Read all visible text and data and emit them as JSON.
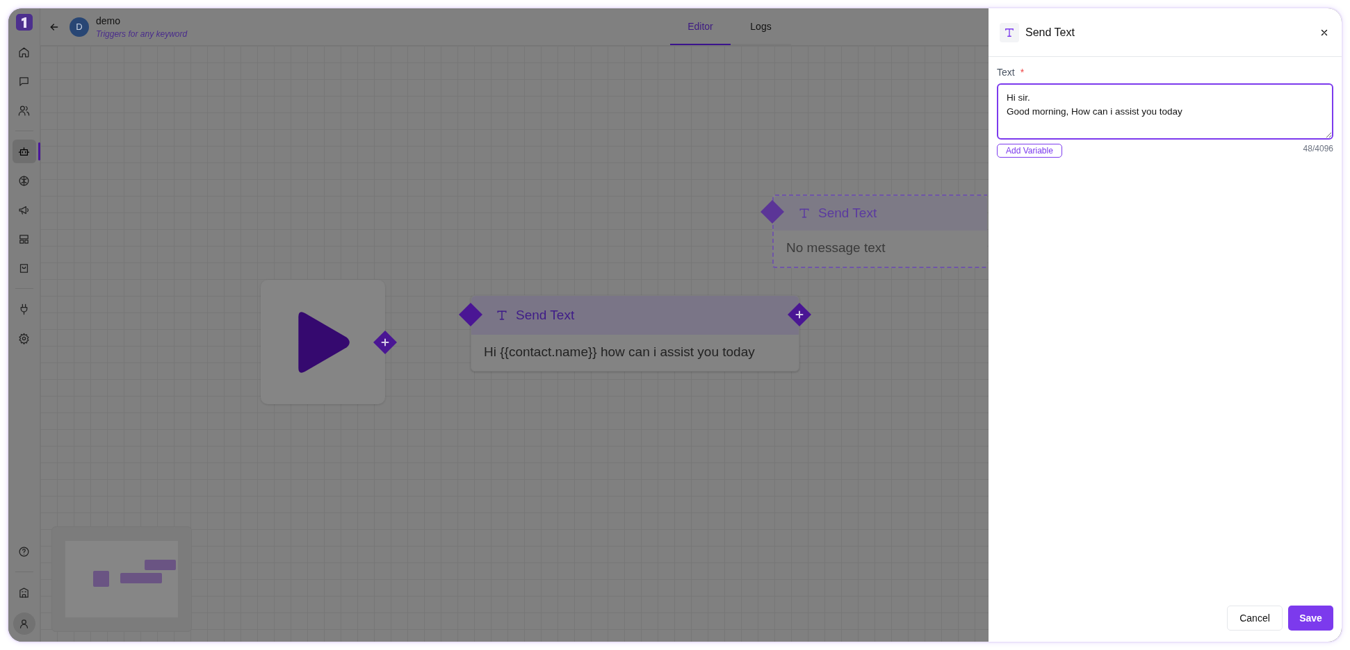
{
  "sidebar": {
    "top_groups": [
      [
        {
          "selected": false
        },
        {
          "selected": false
        },
        {
          "selected": false
        }
      ],
      [
        {
          "selected": true
        },
        {
          "selected": false
        },
        {
          "selected": false
        },
        {
          "selected": false
        },
        {
          "selected": false
        }
      ],
      [
        {
          "selected": false
        },
        {
          "selected": false
        }
      ]
    ],
    "bottom_groups": [
      [
        {
          "selected": false
        }
      ],
      [
        {
          "selected": false
        }
      ]
    ]
  },
  "header": {
    "avatar_letter": "D",
    "title": "demo",
    "subtitle": "Triggers for any keyword"
  },
  "tabs": [
    {
      "label": "Editor",
      "selected": true
    },
    {
      "label": "Logs",
      "selected": false
    }
  ],
  "canvas": {
    "nodes": [
      {
        "kind": "start",
        "output": true
      },
      {
        "kind": "message",
        "title": "Send Text",
        "body": "Hi {{contact.name}} how can i assist you today",
        "draft": false,
        "input": true,
        "output": true
      },
      {
        "kind": "message",
        "title": "Send Text",
        "body": "No message text",
        "draft": true,
        "input": true,
        "output": false
      }
    ]
  },
  "panel": {
    "title": "Send Text",
    "field": {
      "label": "Text",
      "required_mark": "*",
      "value": "Hi sir.\nGood morning, How can i assist you today",
      "counter": "48/4096"
    },
    "add_variable": "Add Variable",
    "buttons": [
      {
        "label": "Cancel",
        "kind": "secondary"
      },
      {
        "label": "Save",
        "kind": "primary"
      }
    ]
  }
}
